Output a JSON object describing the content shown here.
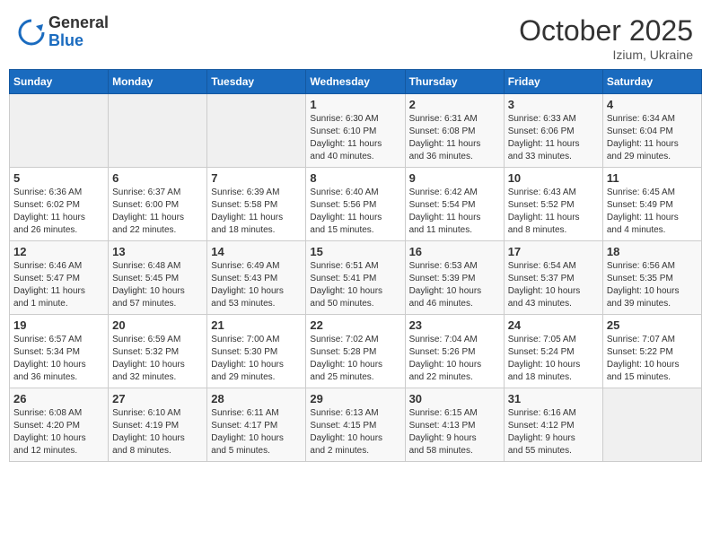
{
  "header": {
    "logo_general": "General",
    "logo_blue": "Blue",
    "month_title": "October 2025",
    "location": "Izium, Ukraine"
  },
  "weekdays": [
    "Sunday",
    "Monday",
    "Tuesday",
    "Wednesday",
    "Thursday",
    "Friday",
    "Saturday"
  ],
  "weeks": [
    [
      {
        "day": "",
        "info": ""
      },
      {
        "day": "",
        "info": ""
      },
      {
        "day": "",
        "info": ""
      },
      {
        "day": "1",
        "info": "Sunrise: 6:30 AM\nSunset: 6:10 PM\nDaylight: 11 hours\nand 40 minutes."
      },
      {
        "day": "2",
        "info": "Sunrise: 6:31 AM\nSunset: 6:08 PM\nDaylight: 11 hours\nand 36 minutes."
      },
      {
        "day": "3",
        "info": "Sunrise: 6:33 AM\nSunset: 6:06 PM\nDaylight: 11 hours\nand 33 minutes."
      },
      {
        "day": "4",
        "info": "Sunrise: 6:34 AM\nSunset: 6:04 PM\nDaylight: 11 hours\nand 29 minutes."
      }
    ],
    [
      {
        "day": "5",
        "info": "Sunrise: 6:36 AM\nSunset: 6:02 PM\nDaylight: 11 hours\nand 26 minutes."
      },
      {
        "day": "6",
        "info": "Sunrise: 6:37 AM\nSunset: 6:00 PM\nDaylight: 11 hours\nand 22 minutes."
      },
      {
        "day": "7",
        "info": "Sunrise: 6:39 AM\nSunset: 5:58 PM\nDaylight: 11 hours\nand 18 minutes."
      },
      {
        "day": "8",
        "info": "Sunrise: 6:40 AM\nSunset: 5:56 PM\nDaylight: 11 hours\nand 15 minutes."
      },
      {
        "day": "9",
        "info": "Sunrise: 6:42 AM\nSunset: 5:54 PM\nDaylight: 11 hours\nand 11 minutes."
      },
      {
        "day": "10",
        "info": "Sunrise: 6:43 AM\nSunset: 5:52 PM\nDaylight: 11 hours\nand 8 minutes."
      },
      {
        "day": "11",
        "info": "Sunrise: 6:45 AM\nSunset: 5:49 PM\nDaylight: 11 hours\nand 4 minutes."
      }
    ],
    [
      {
        "day": "12",
        "info": "Sunrise: 6:46 AM\nSunset: 5:47 PM\nDaylight: 11 hours\nand 1 minute."
      },
      {
        "day": "13",
        "info": "Sunrise: 6:48 AM\nSunset: 5:45 PM\nDaylight: 10 hours\nand 57 minutes."
      },
      {
        "day": "14",
        "info": "Sunrise: 6:49 AM\nSunset: 5:43 PM\nDaylight: 10 hours\nand 53 minutes."
      },
      {
        "day": "15",
        "info": "Sunrise: 6:51 AM\nSunset: 5:41 PM\nDaylight: 10 hours\nand 50 minutes."
      },
      {
        "day": "16",
        "info": "Sunrise: 6:53 AM\nSunset: 5:39 PM\nDaylight: 10 hours\nand 46 minutes."
      },
      {
        "day": "17",
        "info": "Sunrise: 6:54 AM\nSunset: 5:37 PM\nDaylight: 10 hours\nand 43 minutes."
      },
      {
        "day": "18",
        "info": "Sunrise: 6:56 AM\nSunset: 5:35 PM\nDaylight: 10 hours\nand 39 minutes."
      }
    ],
    [
      {
        "day": "19",
        "info": "Sunrise: 6:57 AM\nSunset: 5:34 PM\nDaylight: 10 hours\nand 36 minutes."
      },
      {
        "day": "20",
        "info": "Sunrise: 6:59 AM\nSunset: 5:32 PM\nDaylight: 10 hours\nand 32 minutes."
      },
      {
        "day": "21",
        "info": "Sunrise: 7:00 AM\nSunset: 5:30 PM\nDaylight: 10 hours\nand 29 minutes."
      },
      {
        "day": "22",
        "info": "Sunrise: 7:02 AM\nSunset: 5:28 PM\nDaylight: 10 hours\nand 25 minutes."
      },
      {
        "day": "23",
        "info": "Sunrise: 7:04 AM\nSunset: 5:26 PM\nDaylight: 10 hours\nand 22 minutes."
      },
      {
        "day": "24",
        "info": "Sunrise: 7:05 AM\nSunset: 5:24 PM\nDaylight: 10 hours\nand 18 minutes."
      },
      {
        "day": "25",
        "info": "Sunrise: 7:07 AM\nSunset: 5:22 PM\nDaylight: 10 hours\nand 15 minutes."
      }
    ],
    [
      {
        "day": "26",
        "info": "Sunrise: 6:08 AM\nSunset: 4:20 PM\nDaylight: 10 hours\nand 12 minutes."
      },
      {
        "day": "27",
        "info": "Sunrise: 6:10 AM\nSunset: 4:19 PM\nDaylight: 10 hours\nand 8 minutes."
      },
      {
        "day": "28",
        "info": "Sunrise: 6:11 AM\nSunset: 4:17 PM\nDaylight: 10 hours\nand 5 minutes."
      },
      {
        "day": "29",
        "info": "Sunrise: 6:13 AM\nSunset: 4:15 PM\nDaylight: 10 hours\nand 2 minutes."
      },
      {
        "day": "30",
        "info": "Sunrise: 6:15 AM\nSunset: 4:13 PM\nDaylight: 9 hours\nand 58 minutes."
      },
      {
        "day": "31",
        "info": "Sunrise: 6:16 AM\nSunset: 4:12 PM\nDaylight: 9 hours\nand 55 minutes."
      },
      {
        "day": "",
        "info": ""
      }
    ]
  ]
}
